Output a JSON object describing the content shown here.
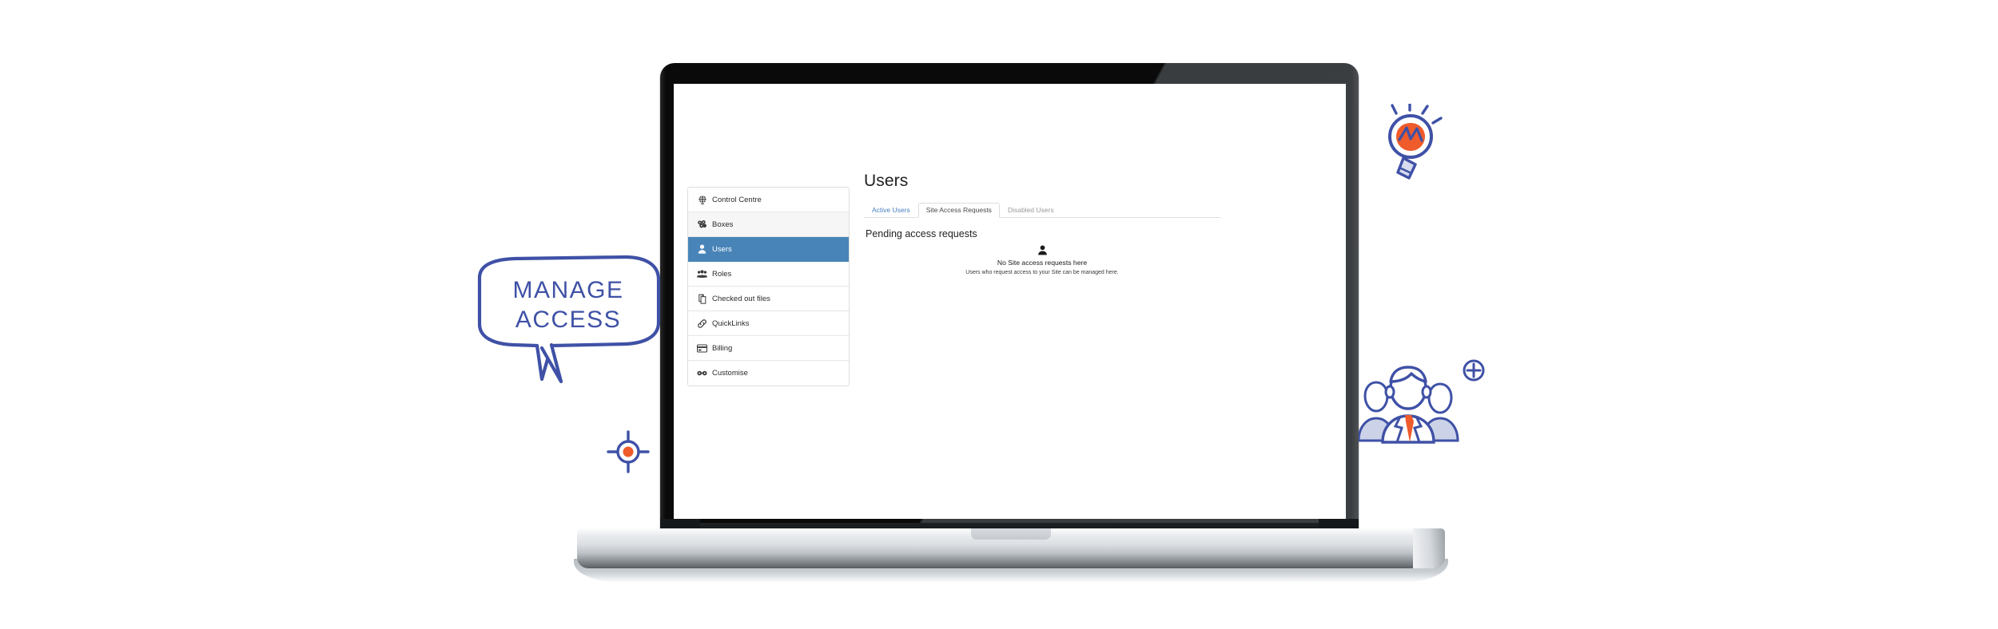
{
  "brand": {
    "accent_blue": "#4884b8",
    "doodle_blue": "#3f51a6",
    "doodle_orange": "#ef5b2b",
    "link_blue": "#4a80c4"
  },
  "sidebar": {
    "items": [
      {
        "label": "Control Centre",
        "icon": "globe-icon",
        "active": false
      },
      {
        "label": "Boxes",
        "icon": "boxes-icon",
        "active": false
      },
      {
        "label": "Users",
        "icon": "user-icon",
        "active": true
      },
      {
        "label": "Roles",
        "icon": "users-group-icon",
        "active": false
      },
      {
        "label": "Checked out files",
        "icon": "copy-files-icon",
        "active": false
      },
      {
        "label": "QuickLinks",
        "icon": "link-icon",
        "active": false
      },
      {
        "label": "Billing",
        "icon": "credit-card-icon",
        "active": false
      },
      {
        "label": "Customise",
        "icon": "glasses-icon",
        "active": false
      }
    ]
  },
  "main": {
    "page_title": "Users",
    "tabs": [
      {
        "label": "Active Users",
        "state": "link"
      },
      {
        "label": "Site Access Requests",
        "state": "active"
      },
      {
        "label": "Disabled Users",
        "state": "inactive"
      }
    ],
    "section_title": "Pending access requests",
    "empty_state": {
      "icon": "person-icon",
      "heading": "No Site access requests here",
      "subtext": "Users who request access to your Site can be managed here."
    }
  },
  "doodles": {
    "speech_bubble": {
      "line1": "MANAGE",
      "line2": "ACCESS"
    },
    "lightbulb_label": "lightbulb-idea-icon",
    "people_group_label": "add-people-group-icon",
    "target_label": "crosshair-target-icon"
  }
}
